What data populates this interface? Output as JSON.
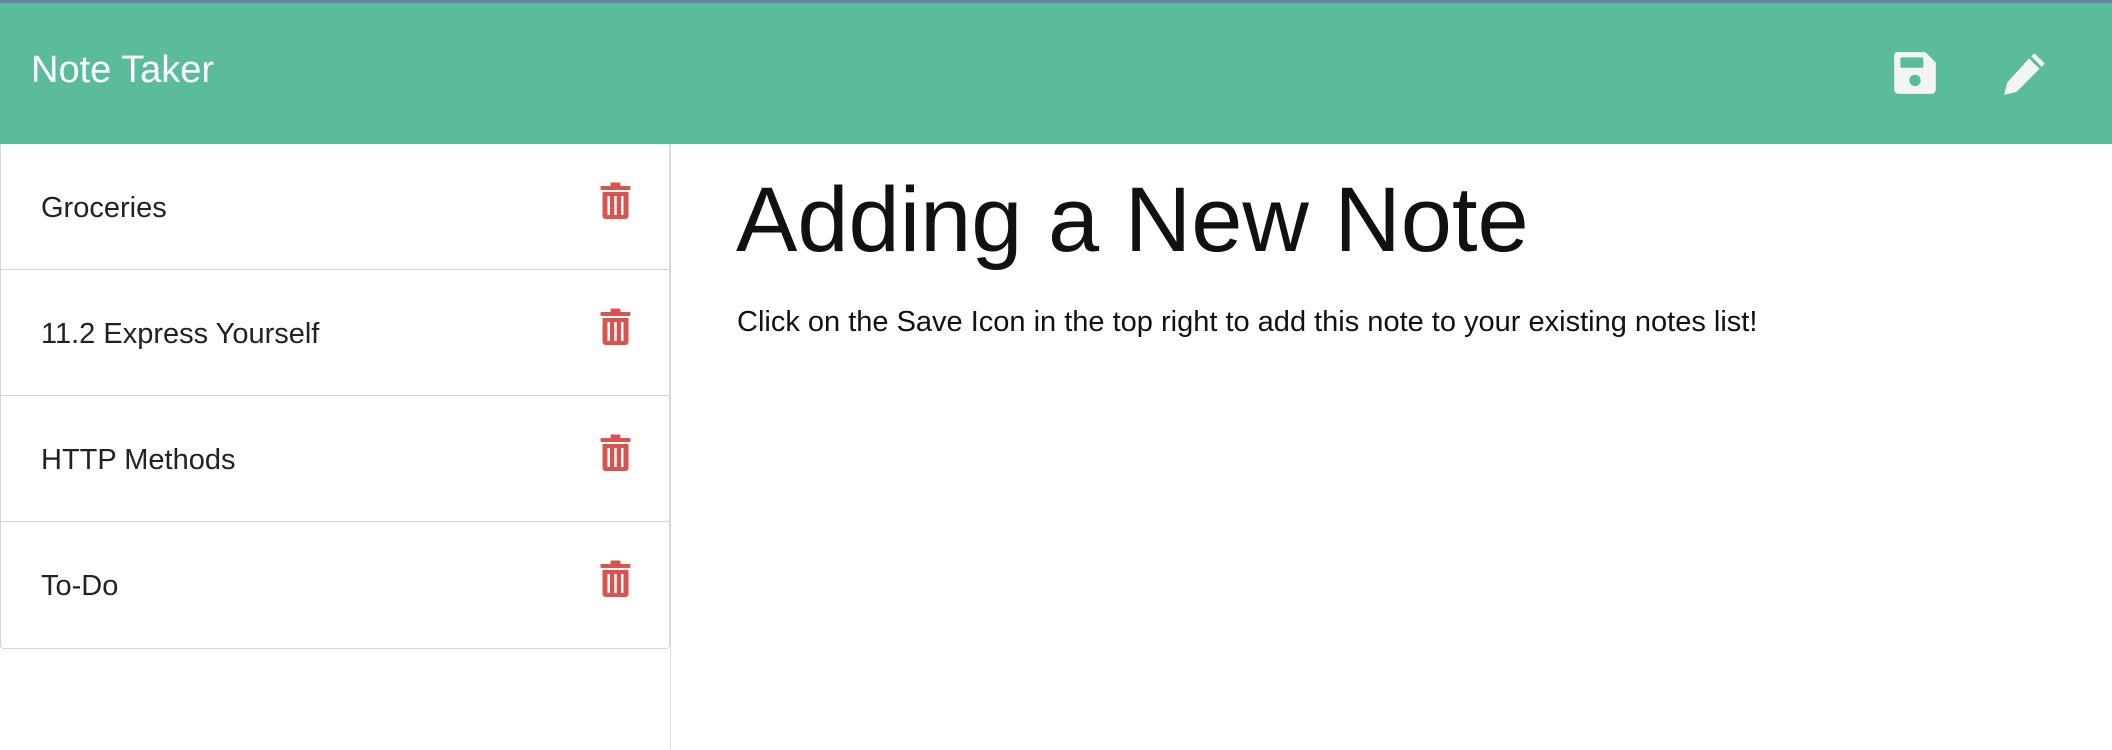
{
  "app": {
    "title": "Note Taker"
  },
  "navbar": {
    "save_icon": "save-icon",
    "new_note_icon": "pencil-icon",
    "background_color": "#5abb9d"
  },
  "notes_list": {
    "items": [
      {
        "title": "Groceries",
        "delete_icon": "trash-icon"
      },
      {
        "title": "11.2 Express Yourself",
        "delete_icon": "trash-icon"
      },
      {
        "title": "HTTP Methods",
        "delete_icon": "trash-icon"
      },
      {
        "title": "To-Do",
        "delete_icon": "trash-icon"
      }
    ],
    "delete_color": "#d9534f"
  },
  "note": {
    "title": "Adding a New Note",
    "text": "Click on the Save Icon in the top right to add this note to your existing notes list!"
  }
}
